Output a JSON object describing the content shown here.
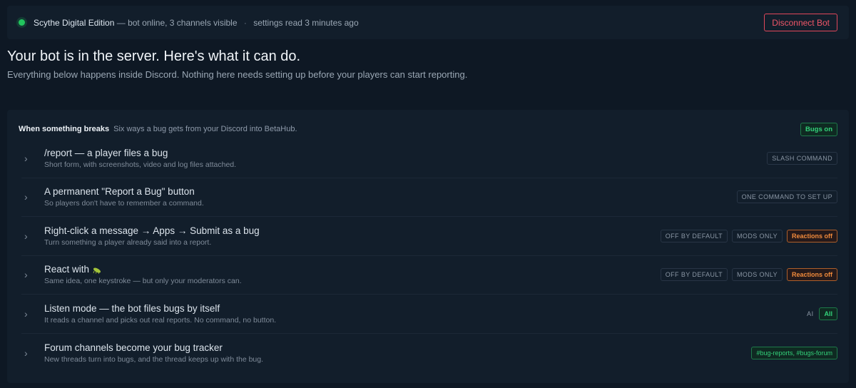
{
  "status": {
    "server_name": "Scythe Digital Edition",
    "bot_state": "— bot online, 3 channels visible",
    "separator": "·",
    "settings_read": "settings read 3 minutes ago",
    "disconnect_label": "Disconnect Bot"
  },
  "intro": {
    "headline": "Your bot is in the server. Here's what it can do.",
    "subline": "Everything below happens inside Discord. Nothing here needs setting up before your players can start reporting."
  },
  "panel": {
    "title": "When something breaks",
    "description": "Six ways a bug gets from your Discord into BetaHub.",
    "status_badge": "Bugs on",
    "rows": [
      {
        "title": "/report — a player files a bug",
        "subtitle": "Short form, with screenshots, video and log files attached.",
        "badges": [
          "SLASH COMMAND"
        ]
      },
      {
        "title": "A permanent \"Report a Bug\" button",
        "subtitle": "So players don't have to remember a command.",
        "badges": [
          "ONE COMMAND TO SET UP"
        ]
      },
      {
        "title": "Right-click a message → Apps → Submit as a bug",
        "subtitle": "Turn something a player already said into a report.",
        "badges": [
          "OFF BY DEFAULT",
          "MODS ONLY",
          "Reactions off"
        ]
      },
      {
        "title": "React with",
        "subtitle": "Same idea, one keystroke — but only your moderators can.",
        "badges": [
          "OFF BY DEFAULT",
          "MODS ONLY",
          "Reactions off"
        ]
      },
      {
        "title": "Listen mode — the bot files bugs by itself",
        "subtitle": "It reads a channel and picks out real reports. No command, no button.",
        "badges": [
          "AI",
          "All"
        ]
      },
      {
        "title": "Forum channels become your bug tracker",
        "subtitle": "New threads turn into bugs, and the thread keeps up with the bug.",
        "badges": [
          "#bug-reports, #bugs-forum"
        ]
      }
    ]
  },
  "colors": {
    "background": "#0e1824",
    "surface": "#121e2b",
    "online": "#22c55e",
    "danger": "#ef5668",
    "success": "#33d17a",
    "warning": "#f28b3c"
  },
  "icons": {
    "status": "online-dot-icon",
    "row_expand": "chevron-right-icon",
    "reaction": "bug-emoji-icon"
  }
}
